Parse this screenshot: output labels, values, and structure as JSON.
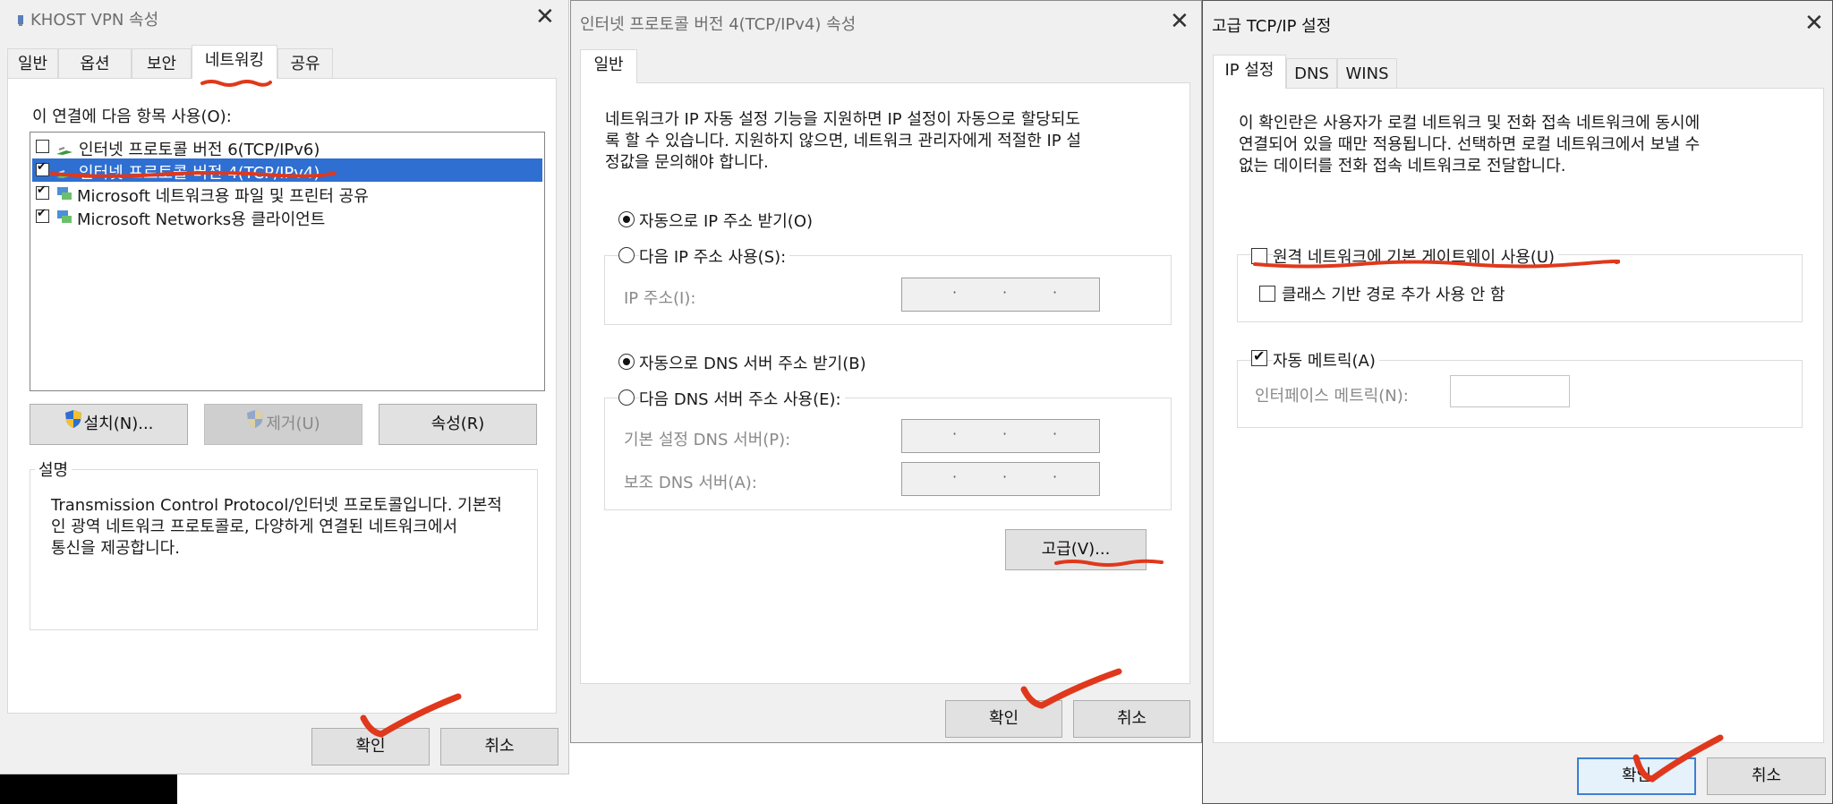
{
  "dlg1": {
    "title": "KHOST VPN 속성",
    "tabs": [
      "일반",
      "옵션",
      "보안",
      "네트워킹",
      "공유"
    ],
    "active_tab": "네트워킹",
    "items_label": "이 연결에 다음 항목 사용(O):",
    "items": [
      {
        "label": "인터넷 프로토콜 버전 6(TCP/IPv6)",
        "checked": false,
        "selected": false
      },
      {
        "label": "인터넷 프로토콜 버전 4(TCP/IPv4)",
        "checked": true,
        "selected": true
      },
      {
        "label": "Microsoft 네트워크용 파일 및 프린터 공유",
        "checked": true,
        "selected": false
      },
      {
        "label": "Microsoft Networks용 클라이언트",
        "checked": true,
        "selected": false
      }
    ],
    "install_btn": "설치(N)...",
    "remove_btn": "제거(U)",
    "props_btn": "속성(R)",
    "desc_title": "설명",
    "desc_line1": "Transmission Control Protocol/인터넷 프로토콜입니다. 기본적",
    "desc_line2": "인 광역 네트워크 프로토콜로, 다양하게 연결된 네트워크에서",
    "desc_line3": "통신을 제공합니다.",
    "ok": "확인",
    "cancel": "취소"
  },
  "dlg2": {
    "title": "인터넷 프로토콜 버전 4(TCP/IPv4) 속성",
    "tab": "일반",
    "intro1": "네트워크가 IP 자동 설정 기능을 지원하면 IP 설정이 자동으로 할당되도",
    "intro2": "록 할 수 있습니다. 지원하지 않으면, 네트워크 관리자에게 적절한 IP 설",
    "intro3": "정값을 문의해야 합니다.",
    "auto_ip": "자동으로 IP 주소 받기(O)",
    "manual_ip": "다음 IP 주소 사용(S):",
    "ip_label": "IP 주소(I):",
    "auto_dns": "자동으로 DNS 서버 주소 받기(B)",
    "manual_dns": "다음 DNS 서버 주소 사용(E):",
    "pref_dns": "기본 설정 DNS 서버(P):",
    "alt_dns": "보조 DNS 서버(A):",
    "advanced": "고급(V)...",
    "ok": "확인",
    "cancel": "취소"
  },
  "dlg3": {
    "title": "고급 TCP/IP 설정",
    "tabs": [
      "IP 설정",
      "DNS",
      "WINS"
    ],
    "desc1": "이 확인란은 사용자가 로컬 네트워크 및 전화 접속 네트워크에 동시에",
    "desc2": "연결되어 있을 때만 적용됩니다. 선택하면 로컬 네트워크에서 보낼 수",
    "desc3": "없는 데이터를 전화 접속 네트워크로 전달합니다.",
    "use_gateway": "원격 네트워크에 기본 게이트웨이 사용(U)",
    "disable_class": "클래스 기반 경로 추가 사용 안 함",
    "auto_metric": "자동 메트릭(A)",
    "iface_metric": "인터페이스 메트릭(N):",
    "ok": "확인",
    "cancel": "취소"
  },
  "colors": {
    "selection": "#2f6fd1",
    "annotation": "#e0381c"
  }
}
